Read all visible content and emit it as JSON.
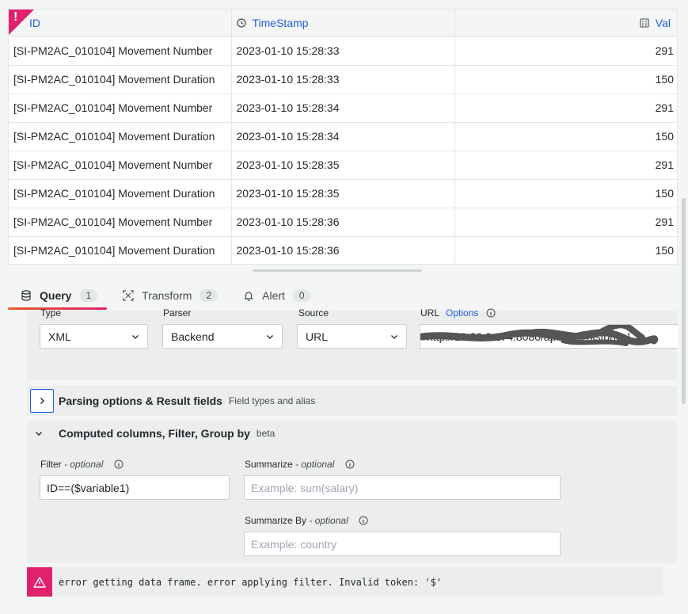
{
  "table": {
    "columns": [
      {
        "label": "ID",
        "icon": "sort-icon"
      },
      {
        "label": "TimeStamp",
        "icon": "clock-icon"
      },
      {
        "label": "Val",
        "icon": "calculator-icon"
      }
    ],
    "rows": [
      [
        "[SI-PM2AC_010104] Movement Number",
        "2023-01-10 15:28:33",
        "291"
      ],
      [
        "[SI-PM2AC_010104] Movement Duration",
        "2023-01-10 15:28:33",
        "150"
      ],
      [
        "[SI-PM2AC_010104] Movement Number",
        "2023-01-10 15:28:34",
        "291"
      ],
      [
        "[SI-PM2AC_010104] Movement Duration",
        "2023-01-10 15:28:34",
        "150"
      ],
      [
        "[SI-PM2AC_010104] Movement Number",
        "2023-01-10 15:28:35",
        "291"
      ],
      [
        "[SI-PM2AC_010104] Movement Duration",
        "2023-01-10 15:28:35",
        "150"
      ],
      [
        "[SI-PM2AC_010104] Movement Number",
        "2023-01-10 15:28:36",
        "291"
      ],
      [
        "[SI-PM2AC_010104] Movement Duration",
        "2023-01-10 15:28:36",
        "150"
      ]
    ],
    "corner_badge": "!"
  },
  "tabs": [
    {
      "label": "Query",
      "count": "1",
      "icon": "database-icon",
      "active": true
    },
    {
      "label": "Transform",
      "count": "2",
      "icon": "transform-icon",
      "active": false
    },
    {
      "label": "Alert",
      "count": "0",
      "icon": "bell-icon",
      "active": false
    }
  ],
  "query": {
    "type_label": "Type",
    "type_value": "XML",
    "parser_label": "Parser",
    "parser_value": "Backend",
    "source_label": "Source",
    "source_value": "URL",
    "url_label": "URL",
    "url_options": "Options",
    "url_value": "http://10.20.0.174:8080/api/data/historical"
  },
  "parsing": {
    "title": "Parsing options & Result fields",
    "subtitle": "Field types and alias"
  },
  "computed": {
    "title": "Computed columns, Filter, Group by",
    "badge": "beta",
    "filter_label": "Filter",
    "filter_optional": "- optional",
    "filter_value": "ID==($variable1)",
    "summarize_label": "Summarize",
    "summarize_optional": "- optional",
    "summarize_placeholder": "Example: sum(salary)",
    "summarize_by_label": "Summarize By",
    "summarize_by_optional": "- optional",
    "summarize_by_placeholder": "Example: country"
  },
  "error": {
    "message": "error getting data frame. error applying filter. Invalid token: '$'"
  },
  "colors": {
    "accent": "#1f62e0",
    "error": "#e0226e",
    "tab_gradient_start": "#f05a28"
  }
}
